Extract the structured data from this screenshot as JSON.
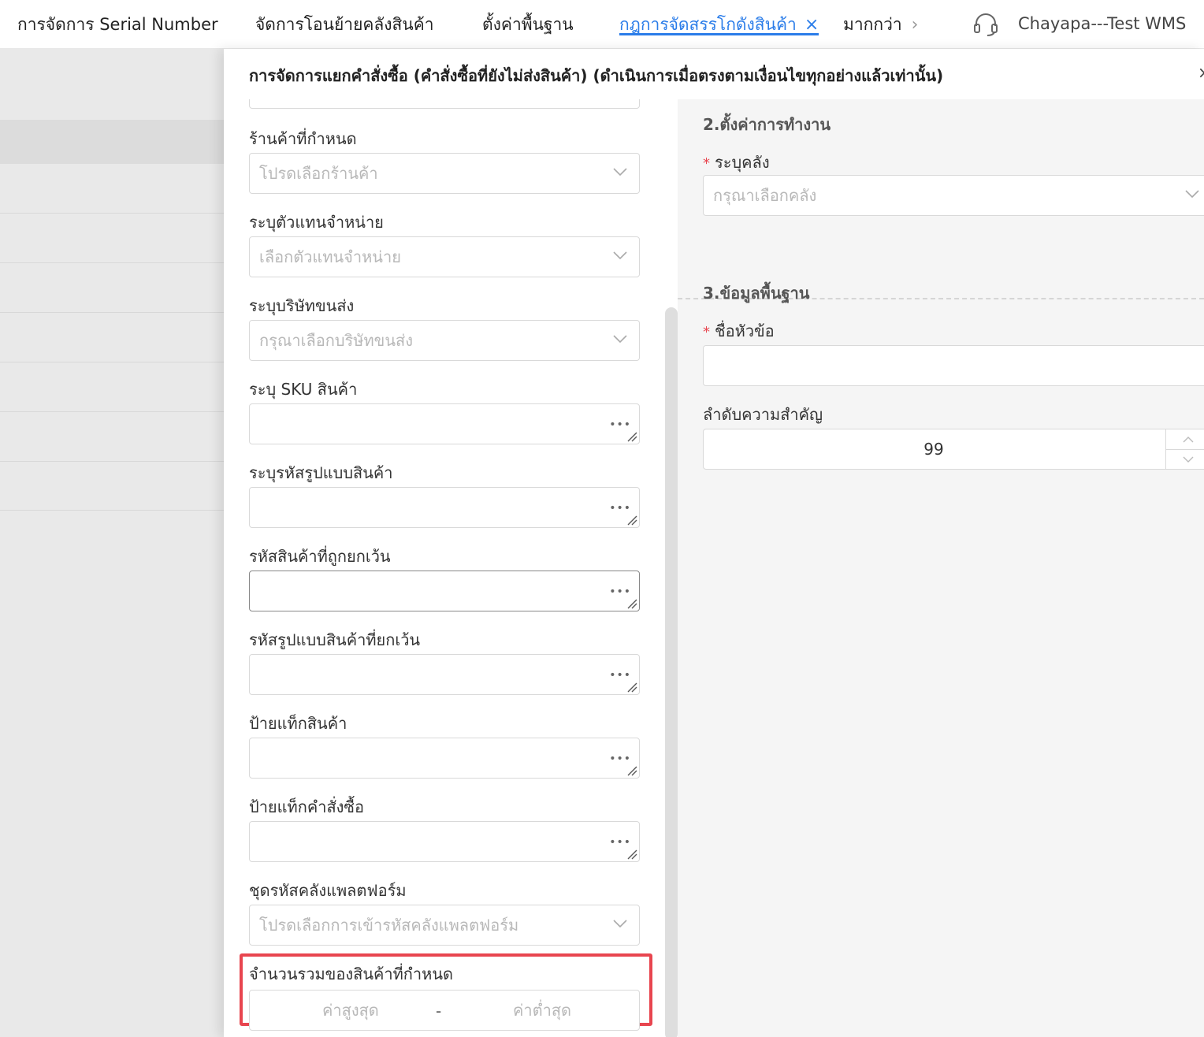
{
  "topbar": {
    "tabs": [
      {
        "label": "การจัดการ Serial Number"
      },
      {
        "label": "จัดการโอนย้ายคลังสินค้า"
      },
      {
        "label": "ตั้งค่าพื้นฐาน"
      },
      {
        "label": "กฎการจัดสรรโกดังสินค้า",
        "close": "×"
      },
      {
        "label": "มากกว่า",
        "chevron": "›"
      }
    ],
    "support_icon": "headset-icon",
    "user_name": "Chayapa---Test WMS"
  },
  "modal": {
    "title": "การจัดการแยกคำสั่งซื้อ (คำสั่งซื้อที่ยังไม่ส่งสินค้า) (ดำเนินการเมื่อตรงตามเงื่อนไขทุกอย่างแล้วเท่านั้น)",
    "close": "×"
  },
  "left_form": {
    "store": {
      "label": "ร้านค้าที่กำหนด",
      "placeholder": "โปรดเลือกร้านค้า"
    },
    "agent": {
      "label": "ระบุตัวแทนจำหน่าย",
      "placeholder": "เลือกตัวแทนจำหน่าย"
    },
    "carrier": {
      "label": "ระบุบริษัทขนส่ง",
      "placeholder": "กรุณาเลือกบริษัทขนส่ง"
    },
    "sku": {
      "label": "ระบุ SKU สินค้า",
      "dots": "•••"
    },
    "style_code": {
      "label": "ระบุรหัสรูปแบบสินค้า",
      "dots": "•••"
    },
    "excluded_product": {
      "label": "รหัสสินค้าที่ถูกยกเว้น",
      "dots": "•••"
    },
    "excluded_style": {
      "label": "รหัสรูปแบบสินค้าที่ยกเว้น",
      "dots": "•••"
    },
    "product_tag": {
      "label": "ป้ายแท็กสินค้า",
      "dots": "•••"
    },
    "order_tag": {
      "label": "ป้ายแท็กคำสั่งซื้อ",
      "dots": "•••"
    },
    "platform_warehouse": {
      "label": "ชุดรหัสคลังแพลตฟอร์ม",
      "placeholder": "โปรดเลือกการเข้ารหัสคลังแพลตฟอร์ม"
    },
    "total_quantity": {
      "label": "จำนวนรวมของสินค้าที่กำหนด",
      "max_placeholder": "ค่าสูงสุด",
      "separator": "-",
      "min_placeholder": "ค่าต่ำสุด"
    }
  },
  "right_form": {
    "section2_title": "2.ตั้งค่าการทำงาน",
    "warehouse": {
      "required": "*",
      "label": "ระบุคลัง",
      "placeholder": "กรุณาเลือกคลัง"
    },
    "section3_title": "3.ข้อมูลพื้นฐาน",
    "topic_name": {
      "required": "*",
      "label": "ชื่อหัวข้อ",
      "value": ""
    },
    "priority": {
      "label": "ลำดับความสำคัญ",
      "value": "99"
    }
  },
  "colors": {
    "accent": "#2b7de9",
    "required": "#e8454f",
    "highlight_frame": "#e8454f"
  }
}
